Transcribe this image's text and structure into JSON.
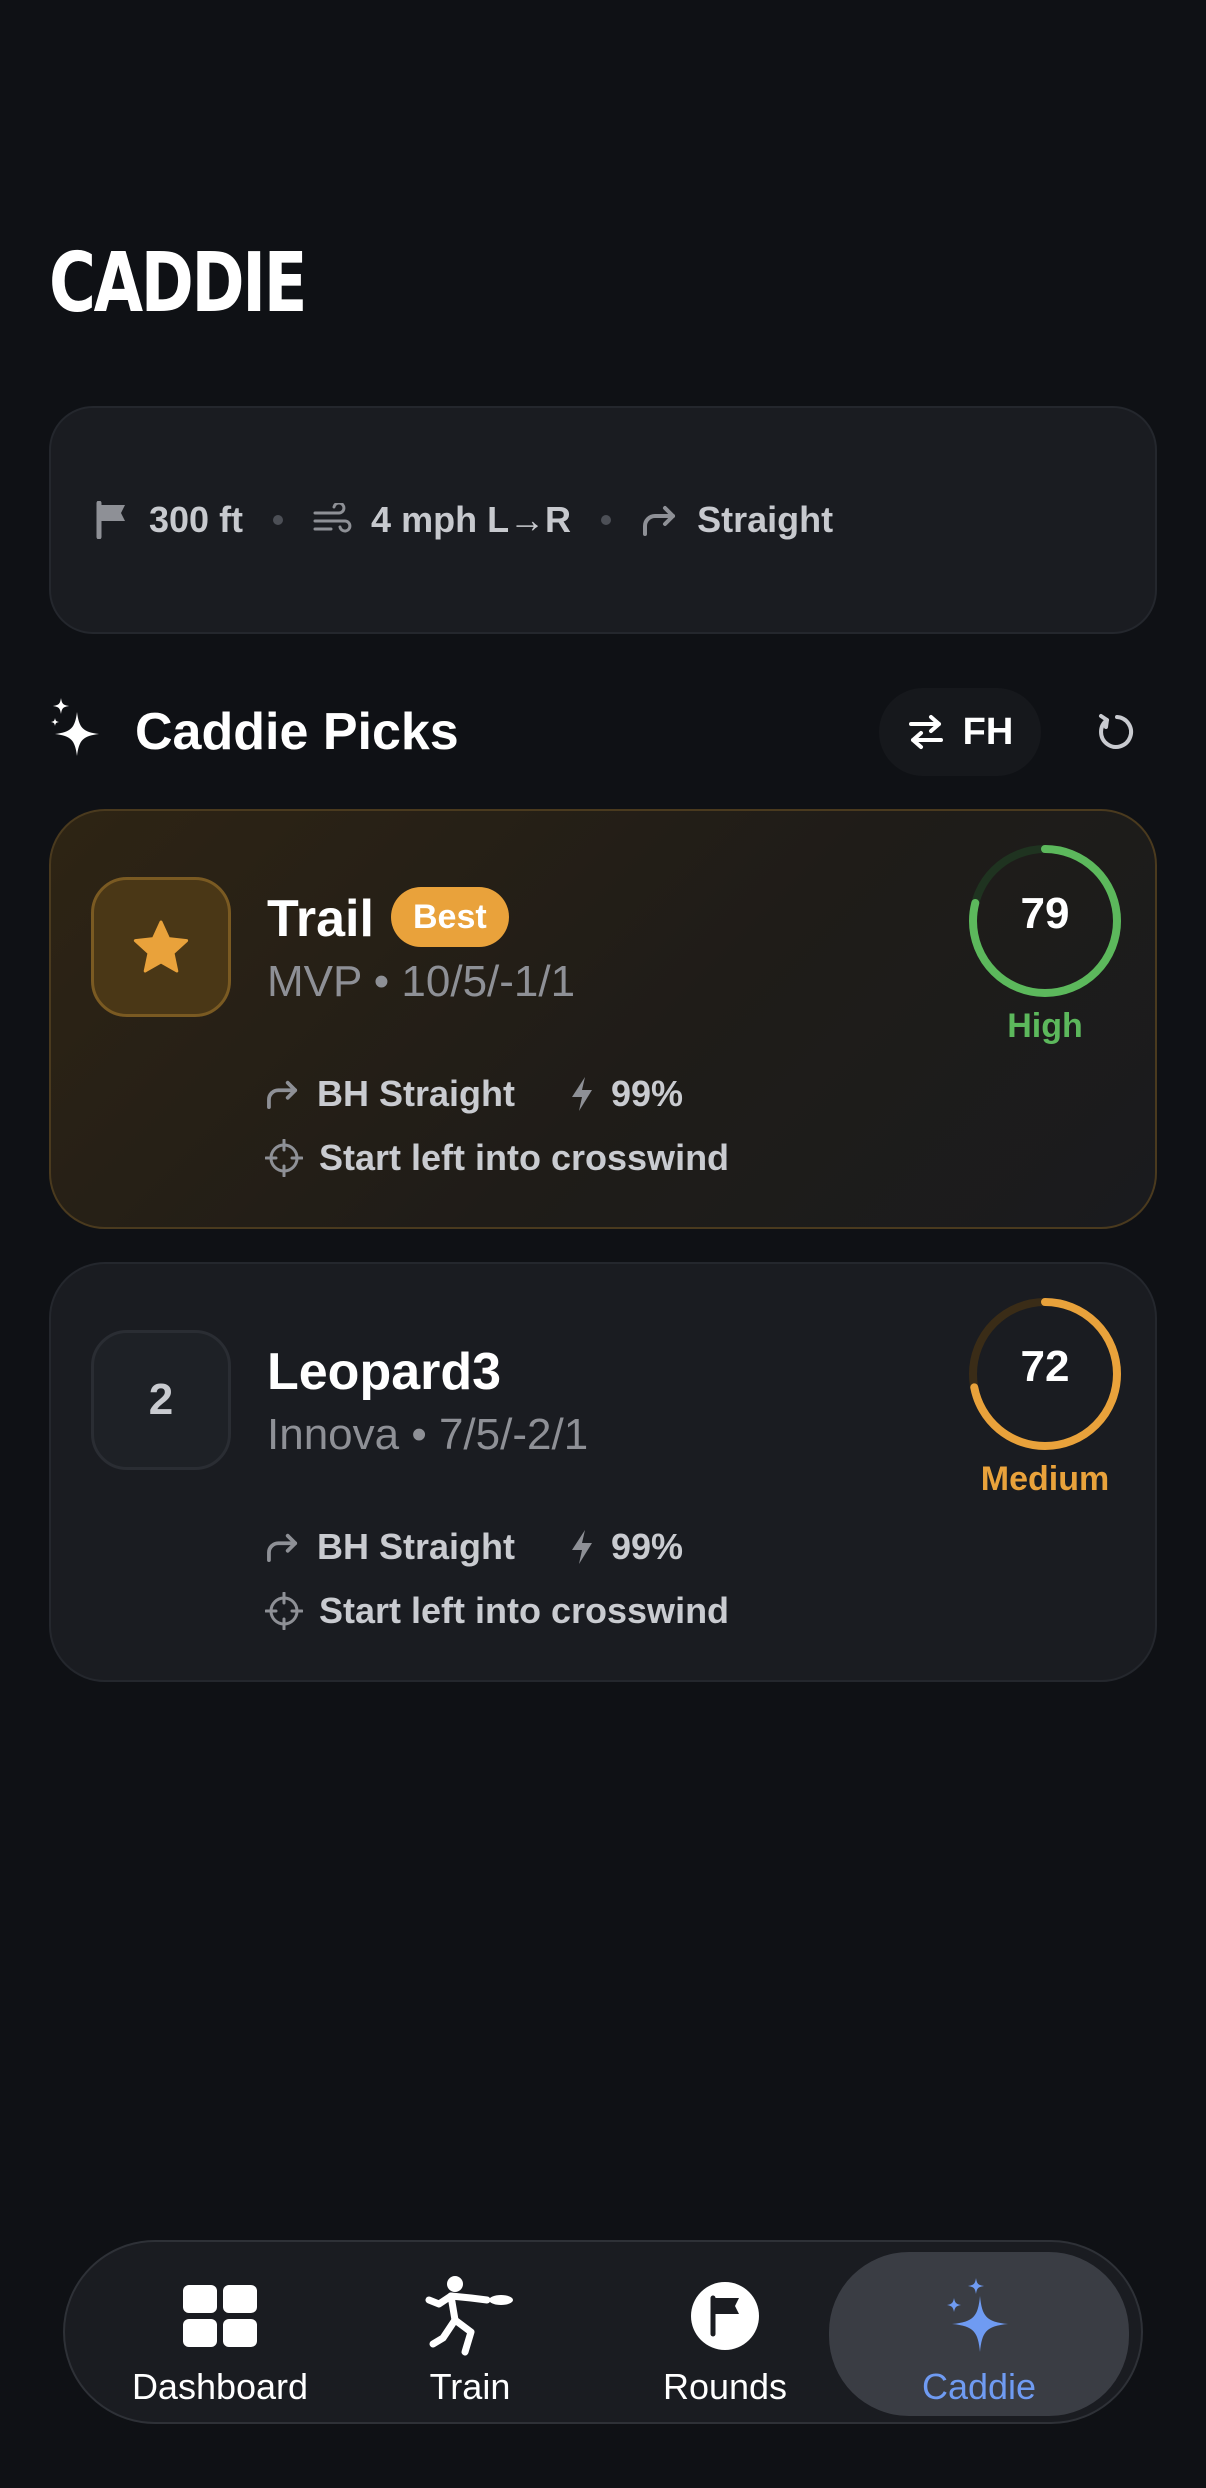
{
  "page": {
    "title": "CADDIE"
  },
  "conditions": {
    "distance": "300 ft",
    "wind": "4 mph L→R",
    "shape": "Straight",
    "icons": [
      "flag-icon",
      "wind-icon",
      "curve-arrow-icon"
    ]
  },
  "section": {
    "title": "Caddie Picks",
    "throw_toggle": "FH"
  },
  "picks": [
    {
      "rank": "",
      "name": "Trail",
      "badge": "Best",
      "meta": "MVP • 10/5/-1/1",
      "throw": "BH Straight",
      "confidence": "99%",
      "tip": "Start left into crosswind",
      "score": "79",
      "score_value": 79,
      "score_label": "High",
      "color": "#5cb85c"
    },
    {
      "rank": "2",
      "name": "Leopard3",
      "meta": "Innova • 7/5/-2/1",
      "throw": "BH Straight",
      "confidence": "99%",
      "tip": "Start left into crosswind",
      "score": "72",
      "score_value": 72,
      "score_label": "Medium",
      "color": "#e9a23b"
    }
  ],
  "tabs": [
    {
      "label": "Dashboard",
      "icon": "dashboard-icon"
    },
    {
      "label": "Train",
      "icon": "train-icon"
    },
    {
      "label": "Rounds",
      "icon": "rounds-icon"
    },
    {
      "label": "Caddie",
      "icon": "caddie-icon",
      "active": true
    }
  ],
  "colors": {
    "background": "#0f1115",
    "accent": "#e9a23b",
    "active_tab": "#6f9bf2",
    "high": "#5cb85c",
    "medium": "#e9a23b"
  }
}
